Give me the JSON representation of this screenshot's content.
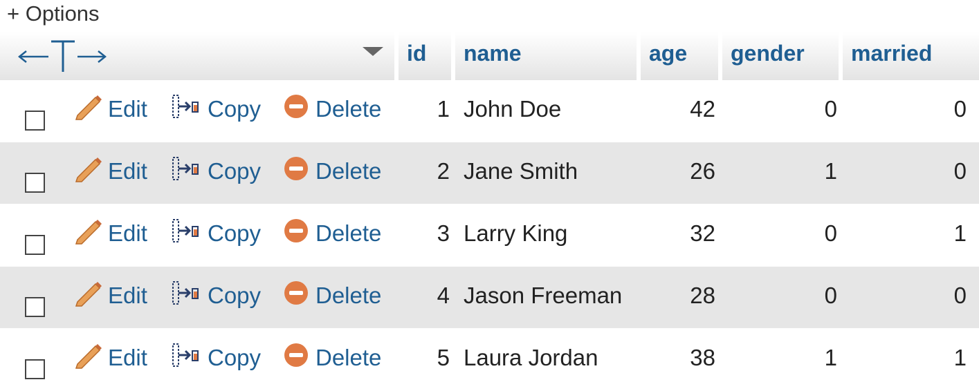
{
  "options_label": "+ Options",
  "columns": [
    "id",
    "name",
    "age",
    "gender",
    "married"
  ],
  "actions": {
    "edit": "Edit",
    "copy": "Copy",
    "delete": "Delete"
  },
  "rows": [
    {
      "id": "1",
      "name": "John Doe",
      "age": "42",
      "gender": "0",
      "married": "0"
    },
    {
      "id": "2",
      "name": "Jane Smith",
      "age": "26",
      "gender": "1",
      "married": "0"
    },
    {
      "id": "3",
      "name": "Larry King",
      "age": "32",
      "gender": "0",
      "married": "1"
    },
    {
      "id": "4",
      "name": "Jason Freeman",
      "age": "28",
      "gender": "0",
      "married": "0"
    },
    {
      "id": "5",
      "name": "Laura Jordan",
      "age": "38",
      "gender": "1",
      "married": "1"
    }
  ],
  "icons": {
    "edit": "pencil-icon",
    "copy": "copy-icon",
    "delete": "delete-icon"
  },
  "colors": {
    "link": "#1f5e92",
    "row_stripe": "#e6e6e6",
    "delete_icon": "#e07a44",
    "pencil": "#d9773a"
  }
}
